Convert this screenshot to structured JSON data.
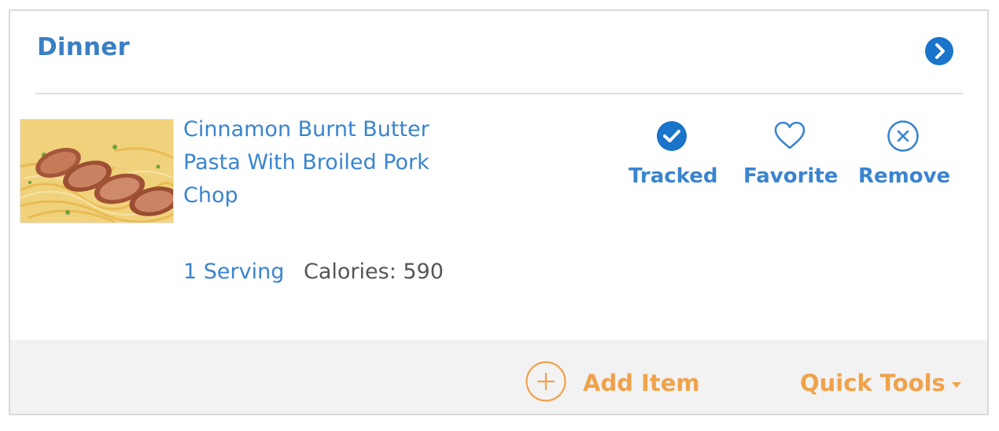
{
  "meal": {
    "title": "Dinner"
  },
  "item": {
    "name": "Cinnamon Burnt Butter Pasta With Broiled Pork Chop",
    "serving": "1 Serving",
    "calories": "Calories: 590"
  },
  "actions": {
    "tracked": "Tracked",
    "favorite": "Favorite",
    "remove": "Remove"
  },
  "footer": {
    "add_item": "Add Item",
    "quick_tools": "Quick Tools"
  },
  "icons": {
    "next": "chevron-right-circle-icon",
    "tracked": "check-circle-icon",
    "favorite": "heart-icon",
    "remove": "close-circle-icon",
    "add": "plus-circle-icon",
    "quick_tools": "caret-down-icon"
  },
  "colors": {
    "primary": "#3a84cf",
    "accent": "#f0a24a",
    "footer_bg": "#f2f2f2"
  }
}
